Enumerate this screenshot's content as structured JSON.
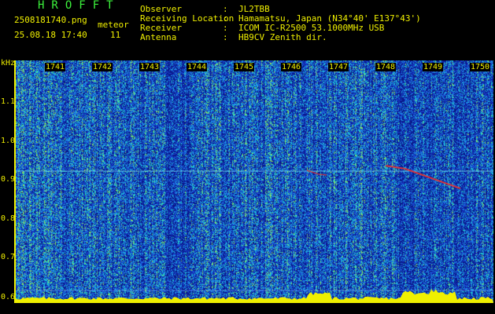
{
  "header": {
    "logo": "HROFFT",
    "filename": "2508181740.png",
    "datetime": "25.08.18 17:40",
    "meteor_label": "meteor",
    "meteor_count": "11",
    "info": [
      {
        "label": "Observer",
        "value": "JL2TBB"
      },
      {
        "label": "Receiving Location",
        "value": "Hamamatsu, Japan (N34°40' E137°43')"
      },
      {
        "label": "Receiver",
        "value": "ICOM IC-R2500 53.1000MHz USB"
      },
      {
        "label": "Antenna",
        "value": "HB9CV Zenith dir."
      }
    ],
    "separator": ":"
  },
  "spectrogram": {
    "y_unit": "kHz",
    "x_ticks": [
      "1741",
      "1742",
      "1743",
      "1744",
      "1745",
      "1746",
      "1747",
      "1748",
      "1749",
      "1750"
    ],
    "y_ticks": [
      "1.1",
      "1.0",
      "0.9",
      "0.8",
      "0.7",
      "0.6"
    ],
    "colors": {
      "noise_dark": "#0a1a8c",
      "noise_mid": "#1e4fd6",
      "noise_hot": "#19d4c9",
      "baseline": "#f0f000",
      "trace": "#e83030"
    }
  }
}
